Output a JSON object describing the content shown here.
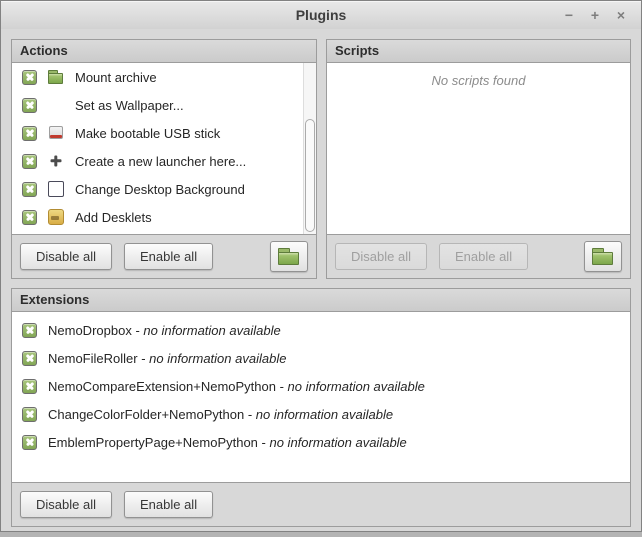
{
  "window": {
    "title": "Plugins",
    "controls": {
      "minimize": "−",
      "maximize": "+",
      "close": "×"
    }
  },
  "colors": {
    "window_bg": "#d8d8d8",
    "panel_border": "#9c9c9c",
    "list_bg": "#ffffff",
    "checkbox_green": "#8fb564",
    "folder_green": "#8db35c",
    "disabled_text": "#9f9f9f",
    "empty_text": "#8c8c8c"
  },
  "actions_panel": {
    "title": "Actions",
    "items": [
      {
        "label": "Mount archive",
        "icon": "folder-icon",
        "checked": true
      },
      {
        "label": "Set as Wallpaper...",
        "icon": "none",
        "checked": true
      },
      {
        "label": "Make bootable USB stick",
        "icon": "usb-imager-icon",
        "checked": true
      },
      {
        "label": "Create a new launcher here...",
        "icon": "plus-icon",
        "checked": true
      },
      {
        "label": "Change Desktop Background",
        "icon": "desktop-background-icon",
        "checked": true
      },
      {
        "label": "Add Desklets",
        "icon": "desklets-icon",
        "checked": true
      }
    ],
    "buttons": {
      "disable_all": "Disable all",
      "enable_all": "Enable all"
    }
  },
  "scripts_panel": {
    "title": "Scripts",
    "empty_message": "No scripts found",
    "buttons": {
      "disable_all": "Disable all",
      "enable_all": "Enable all"
    }
  },
  "extensions_panel": {
    "title": "Extensions",
    "separator": " - ",
    "items": [
      {
        "name": "NemoDropbox",
        "info": "no information available",
        "checked": true
      },
      {
        "name": "NemoFileRoller",
        "info": "no information available",
        "checked": true
      },
      {
        "name": "NemoCompareExtension+NemoPython",
        "info": "no information available",
        "checked": true
      },
      {
        "name": "ChangeColorFolder+NemoPython",
        "info": "no information available",
        "checked": true
      },
      {
        "name": "EmblemPropertyPage+NemoPython",
        "info": "no information available",
        "checked": true
      }
    ],
    "buttons": {
      "disable_all": "Disable all",
      "enable_all": "Enable all"
    }
  }
}
